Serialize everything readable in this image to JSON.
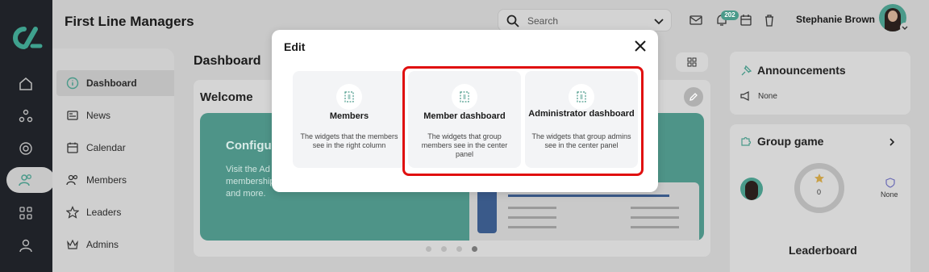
{
  "app": {
    "title": "First Line Managers"
  },
  "search": {
    "placeholder": "Search"
  },
  "header": {
    "notifications_count": "202",
    "user_name": "Stephanie Brown"
  },
  "subnav": {
    "items": [
      {
        "label": "Dashboard",
        "icon": "info-circle-icon",
        "active": true
      },
      {
        "label": "News",
        "icon": "newspaper-icon"
      },
      {
        "label": "Calendar",
        "icon": "calendar-icon"
      },
      {
        "label": "Members",
        "icon": "users-icon"
      },
      {
        "label": "Leaders",
        "icon": "star-icon"
      },
      {
        "label": "Admins",
        "icon": "crown-icon"
      }
    ]
  },
  "main": {
    "title": "Dashboard",
    "welcome_title": "Welcome",
    "banner_title": "Configu",
    "banner_text": "Visit the Ad configuring features, membership settings, permissions, and more."
  },
  "right": {
    "announcements_title": "Announcements",
    "announcements_value": "None",
    "group_game_title": "Group game",
    "score": "0",
    "badge_value": "None",
    "leaderboard_title": "Leaderboard"
  },
  "modal": {
    "title": "Edit",
    "options": [
      {
        "label": "Members",
        "desc": "The widgets that the members see in the right column"
      },
      {
        "label": "Member dashboard",
        "desc": "The widgets that group members see in the center panel"
      },
      {
        "label": "Administrator dashboard",
        "desc": "The widgets that group admins see in the center panel"
      }
    ]
  },
  "colors": {
    "accent": "#4e9488",
    "highlight": "#e01010",
    "rail": "#1f2228"
  }
}
